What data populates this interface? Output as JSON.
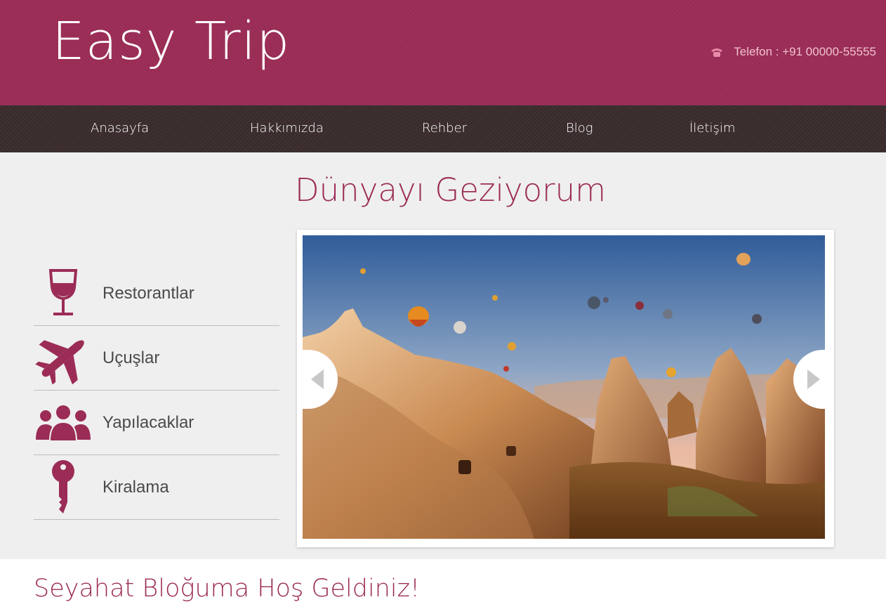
{
  "header": {
    "logo": "Easy Trip",
    "phone_text": "Telefon : +91 00000-55555",
    "phone_icon": "phone-icon"
  },
  "nav": {
    "items": [
      "Anasayfa",
      "Hakkımızda",
      "Rehber",
      "Blog",
      "İletişim"
    ]
  },
  "main": {
    "title": "Dünyayı Geziyorum"
  },
  "sidebar": {
    "items": [
      {
        "label": "Restorantlar",
        "icon": "wine-glass-icon"
      },
      {
        "label": "Uçuşlar",
        "icon": "airplane-icon"
      },
      {
        "label": "Yapılacaklar",
        "icon": "people-group-icon"
      },
      {
        "label": "Kiralama",
        "icon": "key-icon"
      }
    ]
  },
  "slider": {
    "prev_icon": "chevron-left-icon",
    "next_icon": "chevron-right-icon",
    "image": "cappadocia-balloons-photo"
  },
  "welcome": {
    "heading": "Seyahat Bloğuma Hoş Geldiniz!"
  },
  "colors": {
    "brand": "#9b2c56",
    "nav_bg": "#3a2c2c",
    "page_bg": "#efefef"
  }
}
